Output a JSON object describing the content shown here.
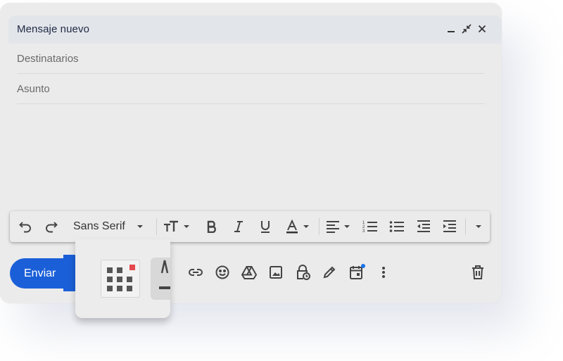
{
  "window": {
    "title": "Mensaje nuevo",
    "controls": [
      "minimize-icon",
      "exit-fullscreen-icon",
      "close-icon"
    ]
  },
  "fields": {
    "recipients_placeholder": "Destinatarios",
    "subject_placeholder": "Asunto"
  },
  "toolbar": {
    "font_name": "Sans Serif",
    "items": [
      "undo-icon",
      "redo-icon",
      "font-select",
      "font-size-icon",
      "bold-icon",
      "italic-icon",
      "underline-icon",
      "text-color-icon",
      "align-icon",
      "numbered-list-icon",
      "bulleted-list-icon",
      "indent-less-icon",
      "indent-more-icon",
      "more-formatting-icon"
    ]
  },
  "actions": {
    "send_label": "Enviar",
    "bottom_icons": [
      "insert-link-icon",
      "emoji-icon",
      "drive-icon",
      "photo-icon",
      "confidential-mode-icon",
      "signature-icon",
      "schedule-icon",
      "more-options-icon",
      "delete-icon"
    ]
  },
  "colors": {
    "accent": "#1b5fd8",
    "notification_dot": "#1a73e8",
    "grid_badge": "#e5484d"
  }
}
